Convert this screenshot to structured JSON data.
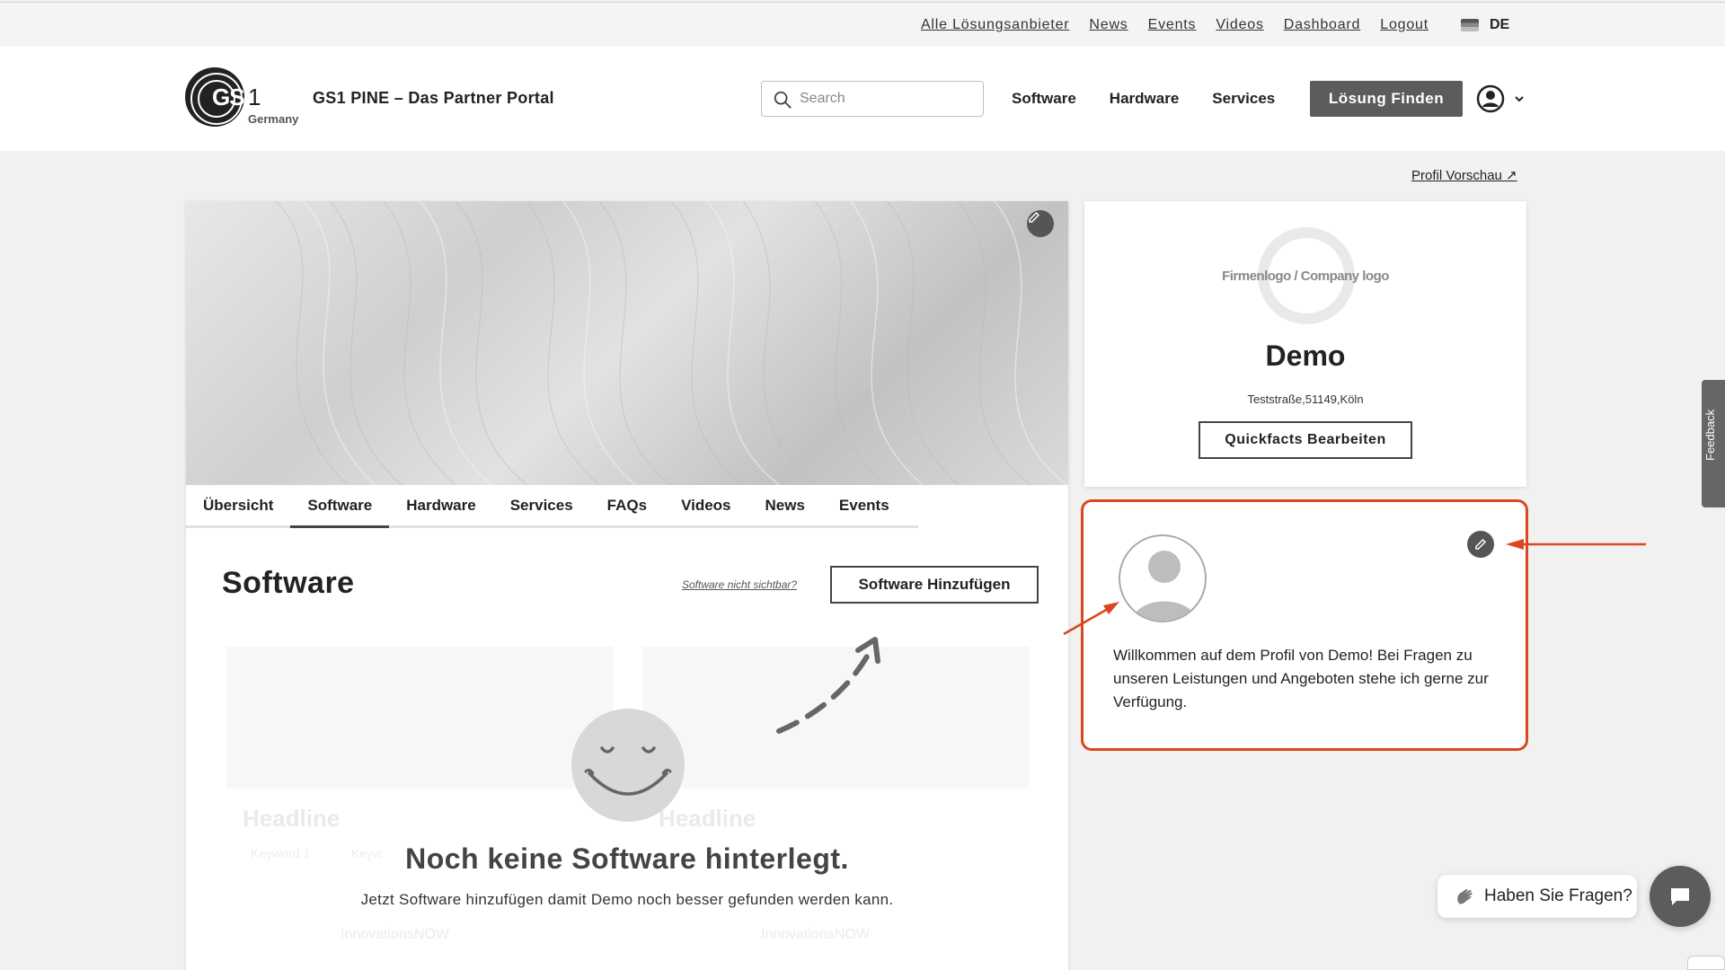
{
  "topbar": {
    "links": [
      "Alle Lösungsanbieter",
      "News",
      "Events",
      "Videos",
      "Dashboard",
      "Logout"
    ],
    "language": "DE"
  },
  "header": {
    "logo_text": "GS",
    "logo_one": "1",
    "logo_sub": "Germany",
    "site_title": "GS1 PINE – Das Partner Portal",
    "search_placeholder": "Search",
    "nav": [
      "Software",
      "Hardware",
      "Services"
    ],
    "find_button": "Lösung Finden"
  },
  "preview_link": "Profil Vorschau ↗",
  "profile_tabs": [
    "Übersicht",
    "Software",
    "Hardware",
    "Services",
    "FAQs",
    "Videos",
    "News",
    "Events"
  ],
  "active_tab": "Software",
  "software_section": {
    "title": "Software",
    "not_visible_link": "Software nicht sichtbar?",
    "add_button": "Software Hinzufügen",
    "ghost_headline": "Headline",
    "ghost_keyword_1": "Keyword 1",
    "ghost_keyword_2": "Keyw",
    "ghost_brand": "InnovationsNOW",
    "empty_title": "Noch keine Software hinterlegt.",
    "empty_subtitle": "Jetzt Software hinzufügen damit Demo noch besser gefunden werden kann."
  },
  "company_card": {
    "logo_placeholder": "Firmenlogo / Company logo",
    "name": "Demo",
    "address": "Teststraße,51149,Köln",
    "quickfacts_button": "Quickfacts Bearbeiten"
  },
  "welcome_card": {
    "text": "Willkommen auf dem Profil von Demo! Bei Fragen zu unseren Leistungen und Angeboten stehe ich gerne zur Verfügung."
  },
  "feedback_tab": "Feedback",
  "chat": {
    "bubble_text": "Haben Sie Fragen?"
  },
  "colors": {
    "accent_annotation": "#d9481f",
    "button_dark": "#5c5c5c"
  }
}
